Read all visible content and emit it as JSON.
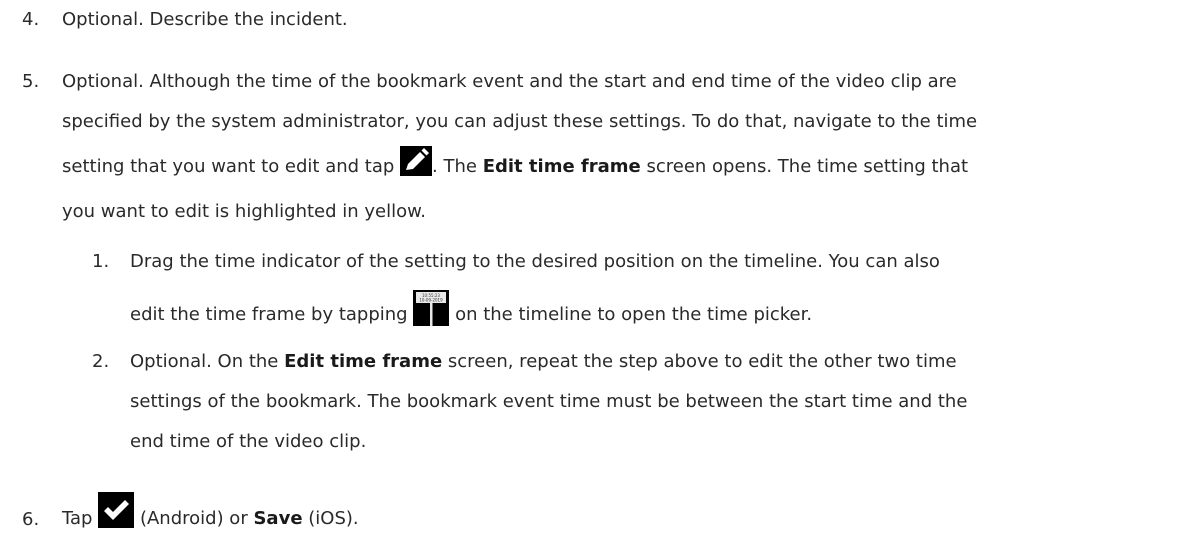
{
  "steps": [
    {
      "num": "4.",
      "text": "Optional. Describe the incident."
    },
    {
      "num": "5.",
      "line1": "Optional. Although the time of the bookmark event and the start and end time of the video clip are",
      "line2": "specified by the system administrator, you can adjust these settings. To do that, navigate to the time",
      "line3_pre": "setting that you want to edit and tap",
      "line3_post1": ". The",
      "line3_bold": "Edit time frame",
      "line3_post2": "screen opens. The time setting that",
      "line4": "you want to edit is highlighted in yellow.",
      "icon": "pencil-edit-icon"
    },
    {
      "num": "6.",
      "pre": "Tap",
      "mid": "(Android) or",
      "bold": "Save",
      "post": "(iOS).",
      "icon": "checkmark-icon"
    }
  ],
  "substeps": [
    {
      "num": "1.",
      "line1": "Drag the time indicator of the setting to the desired position on the timeline. You can also",
      "line2_pre": "edit the time frame by tapping",
      "line2_post": "on the timeline to open the time picker.",
      "icon": "time-marker-icon",
      "icon_text1": "10:55:23",
      "icon_text2": "10-09-2019"
    },
    {
      "num": "2.",
      "line1_pre": "Optional. On the",
      "line1_bold": "Edit time frame",
      "line1_post": "screen, repeat the step above to edit the other two time",
      "line2": "settings of the bookmark. The bookmark event time must be between the start time and the",
      "line3": "end time of the video clip."
    }
  ]
}
